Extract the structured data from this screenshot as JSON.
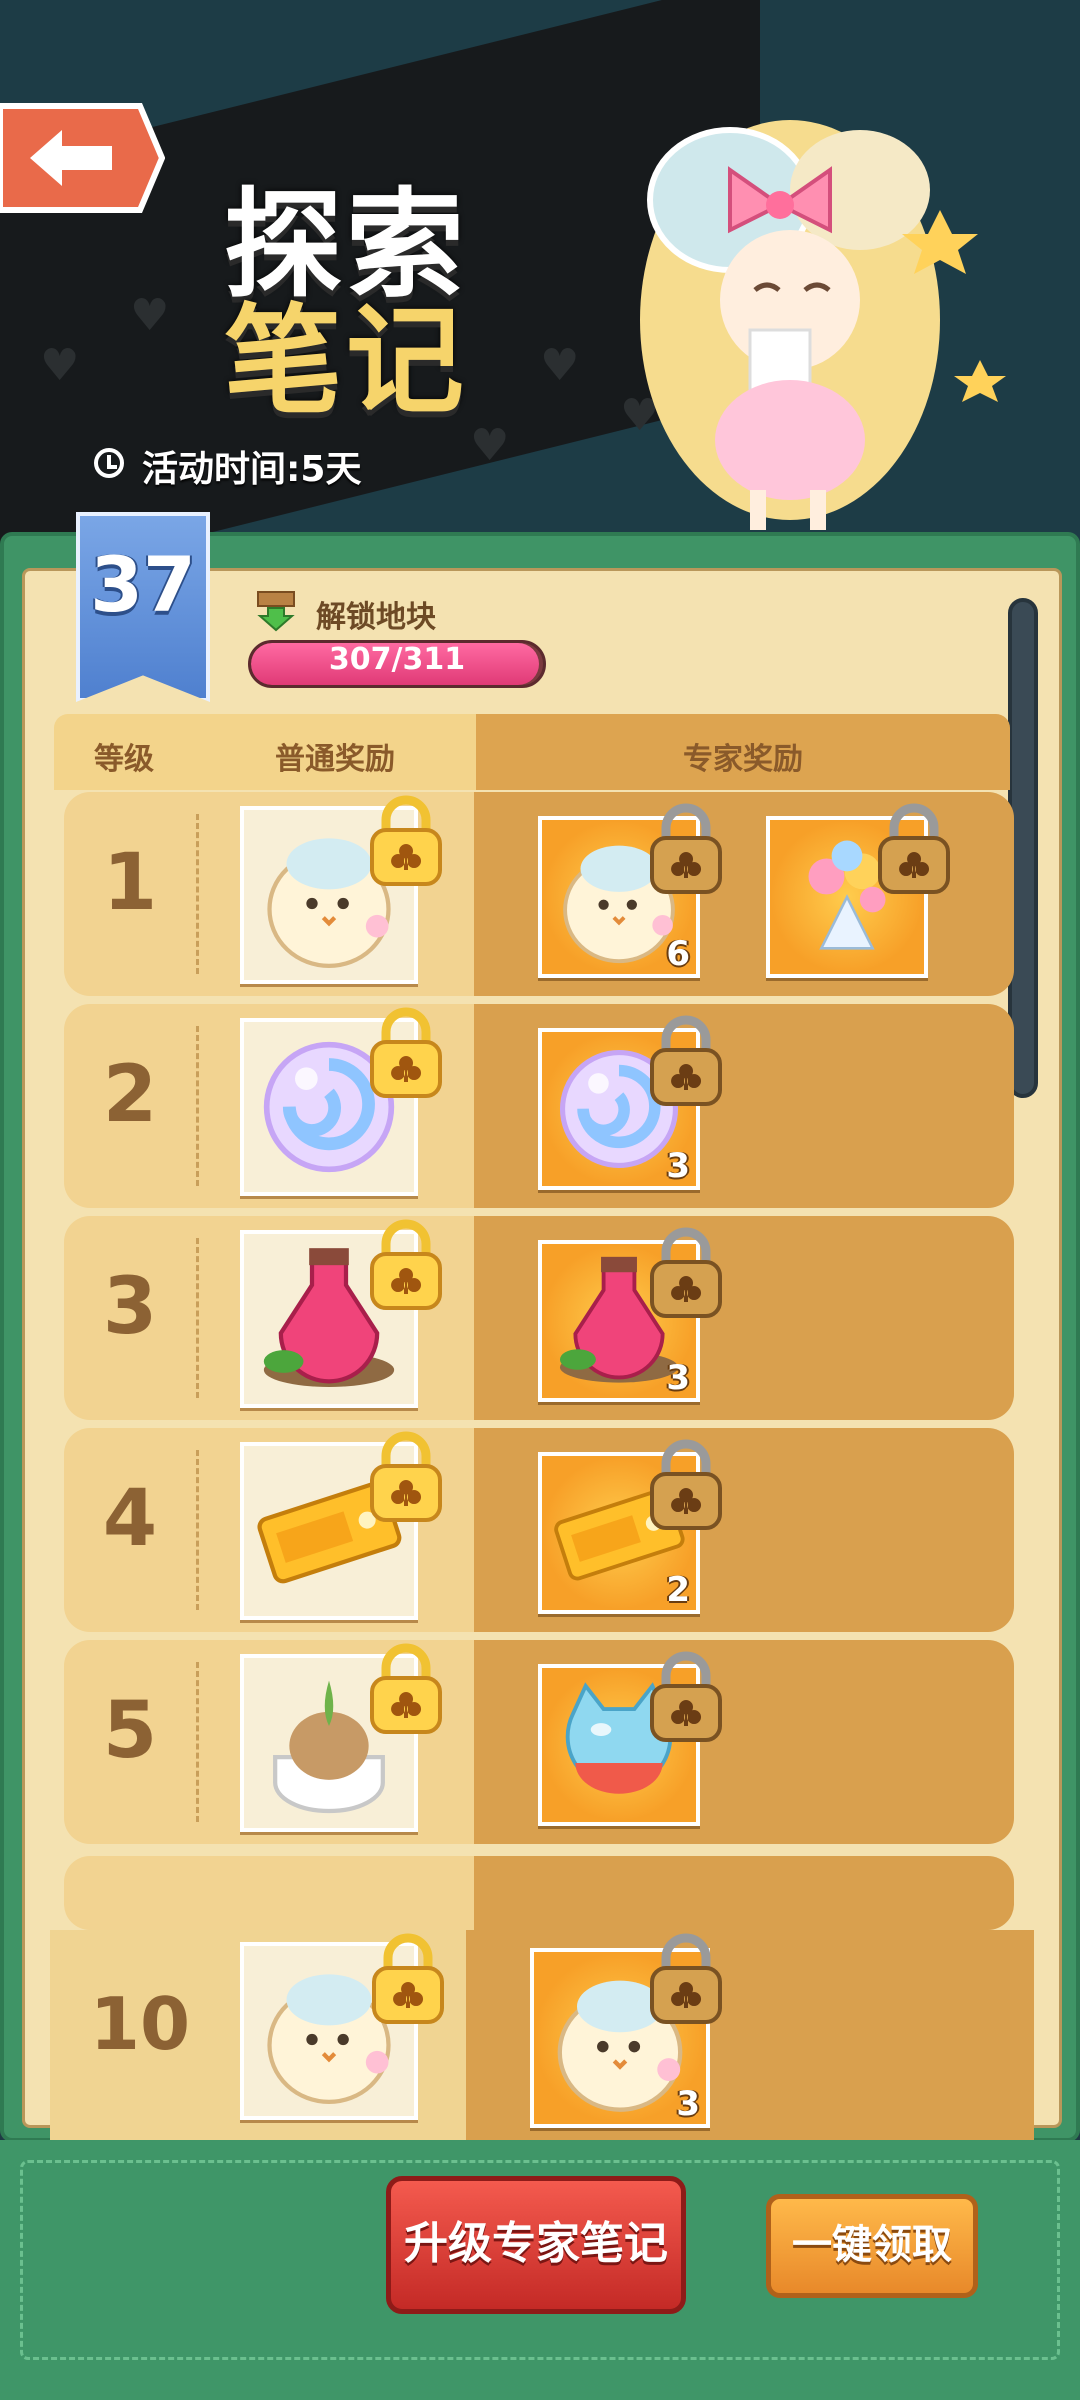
{
  "header": {
    "title_line1": "探索",
    "title_line2": "笔记",
    "activity_time": "活动时间:5天"
  },
  "level": "37",
  "unlock": {
    "label": "解锁地块",
    "progress_text": "307/311",
    "progress_fraction": 0.987
  },
  "table": {
    "columns": [
      "等级",
      "普通奖励",
      "专家奖励"
    ],
    "rows": [
      {
        "level": "1",
        "normal_icon": "chick-plush-icon",
        "expert": [
          {
            "icon": "chick-plush-icon",
            "qty": "6"
          },
          {
            "icon": "flower-bouquet-icon",
            "qty": ""
          }
        ]
      },
      {
        "level": "2",
        "normal_icon": "swirl-orb-icon",
        "expert": [
          {
            "icon": "swirl-orb-icon",
            "qty": "3"
          }
        ]
      },
      {
        "level": "3",
        "normal_icon": "pink-potion-icon",
        "expert": [
          {
            "icon": "pink-potion-icon",
            "qty": "3"
          }
        ]
      },
      {
        "level": "4",
        "normal_icon": "ticket-icon",
        "expert": [
          {
            "icon": "ticket-icon",
            "qty": "2"
          }
        ]
      },
      {
        "level": "5",
        "normal_icon": "bulb-pot-icon",
        "expert": [
          {
            "icon": "cat-gem-icon",
            "qty": ""
          }
        ]
      }
    ],
    "pinned_row": {
      "level": "10",
      "normal_icon": "chick-plush-icon",
      "expert": [
        {
          "icon": "chick-plush-icon",
          "qty": "3"
        }
      ]
    }
  },
  "buttons": {
    "upgrade": "升级专家笔记",
    "claim_all": "一键领取"
  },
  "colors": {
    "panel_green": "#3f9466",
    "paper": "#f4e2b1",
    "expert_col": "#d9a04e",
    "progress_pink": "#e03a76",
    "level_blue": "#4f80cf"
  }
}
